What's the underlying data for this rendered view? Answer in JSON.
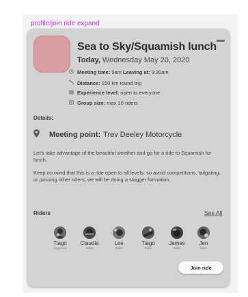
{
  "frame_label": "profile/join ride expand",
  "ride": {
    "title": "Sea to Sky/Squamish lunch",
    "date_prefix": "Today,",
    "date": "Wednesday May 20, 2020",
    "meeting_time_label": "Meeting time:",
    "meeting_time": "9am",
    "leaving_label": "Leaving at:",
    "leaving_time": "9:30am",
    "distance_label": "Distance:",
    "distance": "150 km round trip",
    "experience_label": "Experience level:",
    "experience": "open to everyone",
    "group_label": "Group size:",
    "group": "max 10 riders"
  },
  "details_heading": "Details:",
  "meeting_point": {
    "label": "Meeting point:",
    "value": "Trev Deeley Motorcycle"
  },
  "description": [
    "Let's take advantage of the beautiful weather and go for a ride to Squamish for lunch.",
    "Keep on mind that this is a ride open to all levels; so avoid competitions, tailgating, or passing other riders; we will be doing a stagger formation."
  ],
  "riders": {
    "heading": "Riders",
    "see_all": "See All",
    "list": [
      {
        "name": "Tiago",
        "role": "Organizer"
      },
      {
        "name": "Claudia",
        "role": "Rider"
      },
      {
        "name": "Lee",
        "role": "Rider"
      },
      {
        "name": "Tiago",
        "role": "Rider"
      },
      {
        "name": "James",
        "role": "Rider"
      },
      {
        "name": "Jen",
        "role": "Rider"
      }
    ]
  },
  "join_label": "Join ride",
  "icons": {
    "meeting_time": "clock-icon",
    "distance": "route-icon",
    "experience": "level-icon",
    "group": "group-icon",
    "meeting_point": "map-pin-icon",
    "collapse": "minus-icon"
  },
  "colors": {
    "frame_label": "#c035d6",
    "card": "#d3d3d3",
    "avatar": "#d89ea1"
  }
}
